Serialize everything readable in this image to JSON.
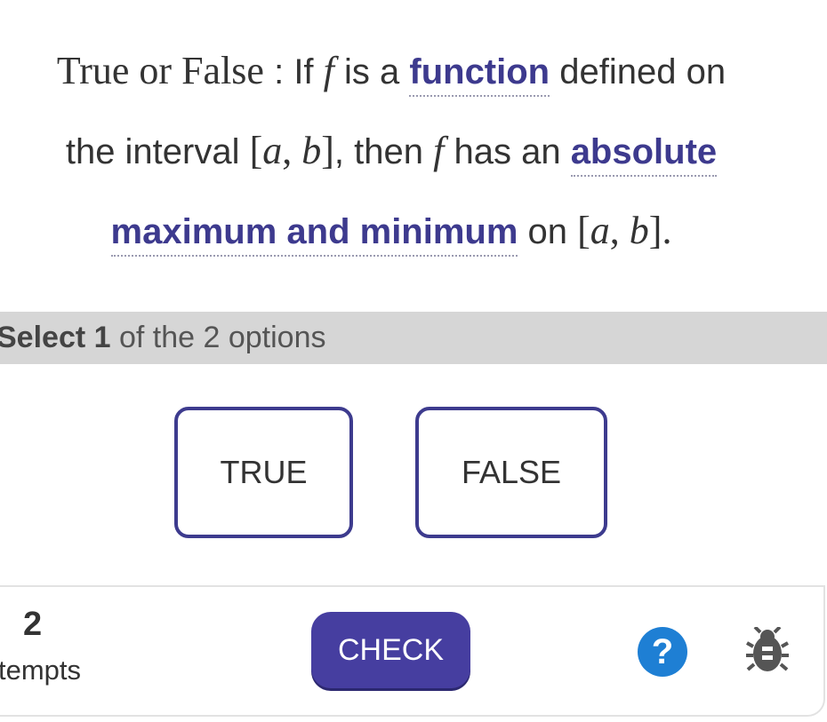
{
  "question": {
    "lead": "True or False",
    "colon": " : ",
    "t1": "If ",
    "f1": "f",
    "t2": " is a ",
    "term1": "function",
    "t3": " defined on",
    "t4": "the interval ",
    "interval1_open": "[",
    "a1": "a",
    "comma1": ", ",
    "b1": "b",
    "interval1_close": "]",
    "t5": ", then ",
    "f2": "f",
    "t6": " has an ",
    "term2a": "absolute",
    "term2b": "maximum and minimum",
    "t7": " on ",
    "interval2_open": "[",
    "a2": "a",
    "comma2": ", ",
    "b2": "b",
    "interval2_close": "].",
    "term_color": "#3d3a8e"
  },
  "banner": {
    "prefix": "Select ",
    "count": "1",
    "suffix": " of the 2 options"
  },
  "options": [
    {
      "label": "TRUE"
    },
    {
      "label": "FALSE"
    }
  ],
  "footer": {
    "attempts_number": "2",
    "attempts_label": "tempts",
    "check_label": "CHECK",
    "help_glyph": "?",
    "help_icon": "question-icon",
    "bug_icon": "bug-icon",
    "check_color": "#463ea0",
    "help_color": "#1e7fd4"
  }
}
